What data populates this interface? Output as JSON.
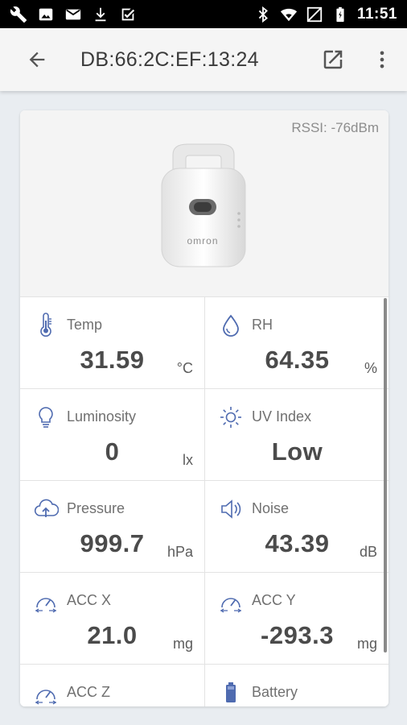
{
  "status_bar": {
    "time": "11:51",
    "left_icons": [
      "wrench-icon",
      "image-icon",
      "mail-icon",
      "download-icon",
      "checklist-icon"
    ],
    "right_icons": [
      "bluetooth-icon",
      "wifi-icon",
      "signal-icon",
      "battery-icon"
    ]
  },
  "app_bar": {
    "title": "DB:66:2C:EF:13:24",
    "back_icon": "arrow-back-icon",
    "open_icon": "open-external-icon",
    "menu_icon": "more-vert-icon"
  },
  "device": {
    "rssi": "RSSI: -76dBm",
    "brand": "omron"
  },
  "sensors": [
    {
      "label": "Temp",
      "value": "31.59",
      "unit": "°C",
      "icon": "thermometer-icon"
    },
    {
      "label": "RH",
      "value": "64.35",
      "unit": "%",
      "icon": "droplet-icon"
    },
    {
      "label": "Luminosity",
      "value": "0",
      "unit": "lx",
      "icon": "lightbulb-icon"
    },
    {
      "label": "UV Index",
      "value": "Low",
      "unit": "",
      "icon": "sun-icon"
    },
    {
      "label": "Pressure",
      "value": "999.7",
      "unit": "hPa",
      "icon": "cloud-upload-icon"
    },
    {
      "label": "Noise",
      "value": "43.39",
      "unit": "dB",
      "icon": "speaker-icon"
    },
    {
      "label": "ACC X",
      "value": "21.0",
      "unit": "mg",
      "icon": "gauge-icon"
    },
    {
      "label": "ACC Y",
      "value": "-293.3",
      "unit": "mg",
      "icon": "gauge-icon"
    },
    {
      "label": "ACC Z",
      "value": "",
      "unit": "",
      "icon": "gauge-icon"
    },
    {
      "label": "Battery",
      "value": "",
      "unit": "",
      "icon": "battery-icon"
    }
  ]
}
